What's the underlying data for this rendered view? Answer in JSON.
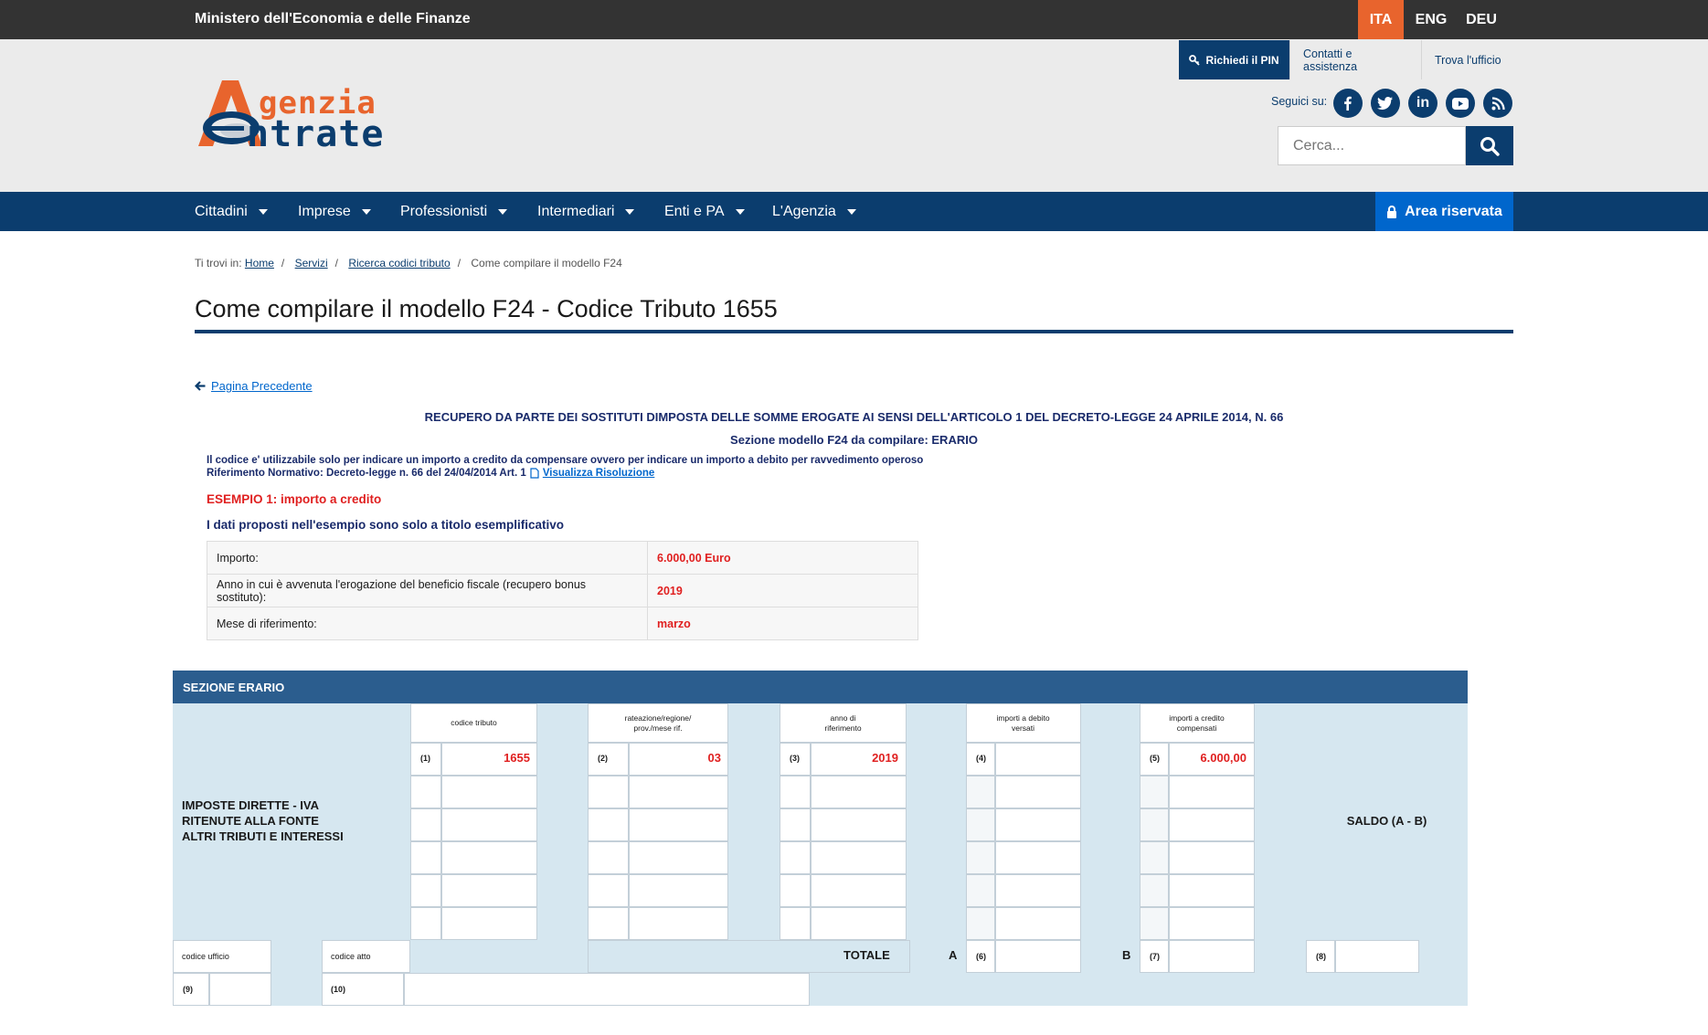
{
  "topbar": {
    "ministry": "Ministero dell'Economia e delle Finanze",
    "languages": [
      "ITA",
      "ENG",
      "DEU"
    ],
    "active_language": "ITA"
  },
  "header": {
    "logo_line1": "genzia",
    "logo_line2": "ntrate",
    "pin_button": "Richiedi il PIN",
    "links": [
      "Contatti e assistenza",
      "Trova l'ufficio"
    ],
    "social_label": "Seguici su:",
    "social_icons": [
      "facebook-icon",
      "twitter-icon",
      "linkedin-icon",
      "youtube-icon",
      "rss-icon"
    ],
    "search_placeholder": "Cerca..."
  },
  "nav": {
    "items": [
      "Cittadini",
      "Imprese",
      "Professionisti",
      "Intermediari",
      "Enti e PA",
      "L'Agenzia"
    ],
    "reserved": "Area riservata"
  },
  "breadcrumb": {
    "prefix": "Ti trovi in:",
    "items": [
      "Home",
      "Servizi",
      "Ricerca codici tributo"
    ],
    "current": "Come compilare il modello F24"
  },
  "page": {
    "title": "Come compilare il modello F24 - Codice Tributo 1655",
    "back": "Pagina Precedente",
    "heading": "RECUPERO DA PARTE DEI SOSTITUTI DIMPOSTA DELLE SOMME EROGATE AI SENSI DELL'ARTICOLO 1 DEL DECRETO-LEGGE 24 APRILE 2014, N. 66",
    "section_line": "Sezione modello F24 da compilare: ERARIO",
    "desc1": "Il codice e' utilizzabile solo per indicare un importo a credito da compensare ovvero per indicare un importo a debito per ravvedimento operoso",
    "desc2": "Riferimento Normativo: Decreto-legge  n. 66 del 24/04/2014 Art. 1",
    "desc2_link": "Visualizza Risoluzione",
    "example_title": "ESEMPIO 1: importo a credito",
    "example_note": "I dati proposti nell'esempio sono solo a titolo esemplificativo"
  },
  "example_table": [
    {
      "label": "Importo:",
      "value": "6.000,00 Euro"
    },
    {
      "label": "Anno in cui è avvenuta l'erogazione del beneficio fiscale (recupero bonus sostituto):",
      "value": "2019"
    },
    {
      "label": "Mese di riferimento:",
      "value": "marzo"
    }
  ],
  "f24": {
    "header": "SEZIONE ERARIO",
    "left_label": [
      "IMPOSTE DIRETTE - IVA",
      "RITENUTE ALLA FONTE",
      "ALTRI TRIBUTI E INTERESSI"
    ],
    "col_codice": "codice tributo",
    "col_rateazione": [
      "rateazione/regione/",
      "prov./mese rif."
    ],
    "col_anno": [
      "anno di",
      "riferimento"
    ],
    "col_debito": [
      "importi a debito",
      "versati"
    ],
    "col_credito": [
      "importi a credito",
      "compensati"
    ],
    "saldo": "SALDO (A - B)",
    "n1": "(1)",
    "n2": "(2)",
    "n3": "(3)",
    "n4": "(4)",
    "n5": "(5)",
    "n6": "(6)",
    "n7": "(7)",
    "n8": "(8)",
    "n9": "(9)",
    "n10": "(10)",
    "v_codice": "1655",
    "v_rateazione": "03",
    "v_anno": "2019",
    "v_credito": "6.000,00",
    "codice_ufficio": "codice ufficio",
    "codice_atto": "codice atto",
    "totale": "TOTALE",
    "a": "A",
    "b": "B"
  }
}
